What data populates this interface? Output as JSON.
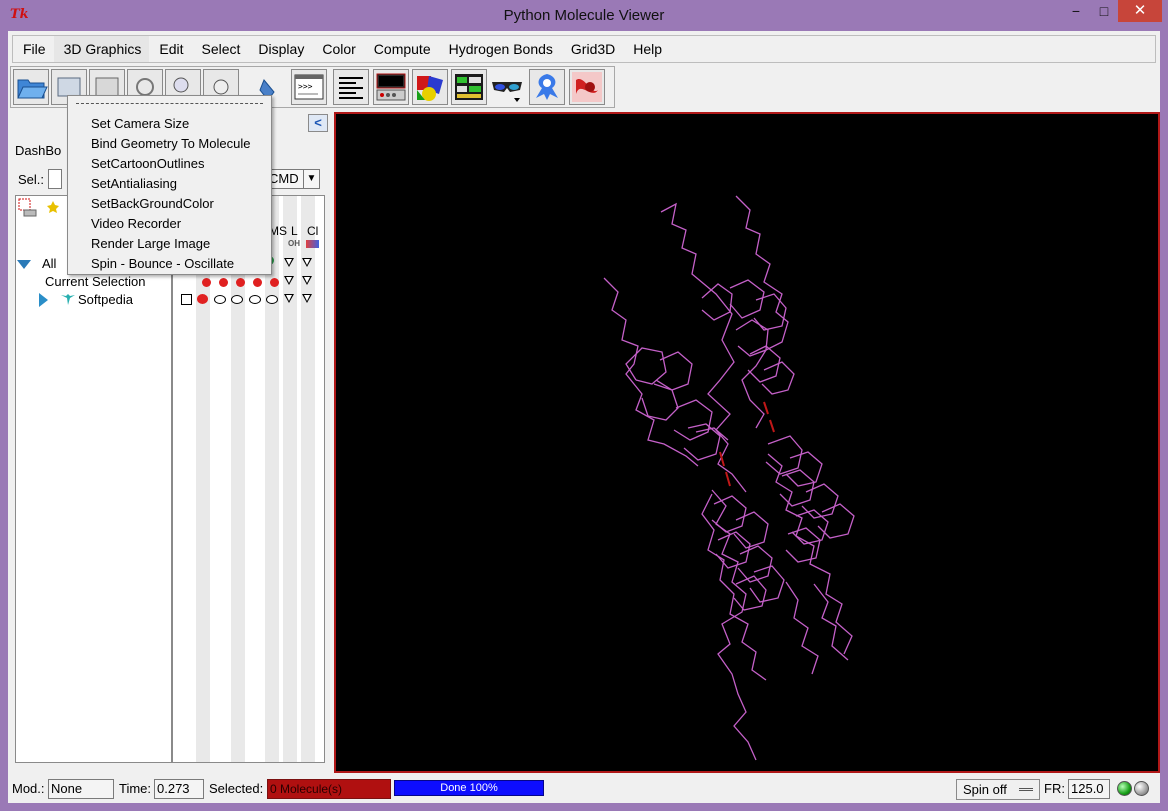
{
  "window": {
    "title": "Python Molecule Viewer",
    "app_icon": "tk-feather-icon",
    "minimize_glyph": "−",
    "maximize_glyph": "□",
    "close_glyph": "✕"
  },
  "menubar": {
    "items": [
      "File",
      "3D Graphics",
      "Edit",
      "Select",
      "Display",
      "Color",
      "Compute",
      "Hydrogen Bonds",
      "Grid3D",
      "Help"
    ],
    "open_item": "3D Graphics"
  },
  "dropdown": {
    "items": [
      "Set Camera Size",
      "Bind Geometry To Molecule",
      "SetCartoonOutlines",
      "SetAntialiasing",
      "SetBackGroundColor",
      "Video Recorder",
      "Render Large Image",
      "Spin - Bounce - Oscillate"
    ]
  },
  "toolbar": {
    "icons": [
      "open-file-icon",
      "load-icon",
      "save-icon",
      "undo-icon",
      "zoom-icon",
      "lighting-icon",
      "shape-icon",
      "python-shell-icon",
      "text-lines-icon",
      "message-box-icon",
      "shapes-color-icon",
      "dashboard-icon",
      "stereo-glasses-icon",
      "molecule-surface-icon",
      "ribbon-icon"
    ],
    "python_shell_text": ">>>"
  },
  "left_panel": {
    "dashboard_label": "DashBo",
    "collapse_glyph": "<",
    "sel_label": "Sel.:",
    "cmd_label": "CMD",
    "cmd_arrow": "▼",
    "column_headers": [
      "MS",
      "L",
      "Cl"
    ],
    "sub_header_L": "OH",
    "tree": {
      "all_label": "All",
      "current_selection": "Current Selection",
      "molecule": "Softpedia"
    }
  },
  "statusbar": {
    "mod_label": "Mod.:",
    "mod_value": "None",
    "time_label": "Time:",
    "time_value": "0.273",
    "selected_label": "Selected:",
    "selected_value": "0 Molecule(s)",
    "progress_text": "Done 100%",
    "progress": 1.0,
    "spin_label": "Spin off",
    "fr_label": "FR:",
    "fr_value": "125.0"
  },
  "colors": {
    "molecule": "#c460c8",
    "hbond": "#c01818",
    "viewer_border": "#b01818",
    "selected_bg": "#b01010",
    "progress_bg": "#0d0dff"
  }
}
